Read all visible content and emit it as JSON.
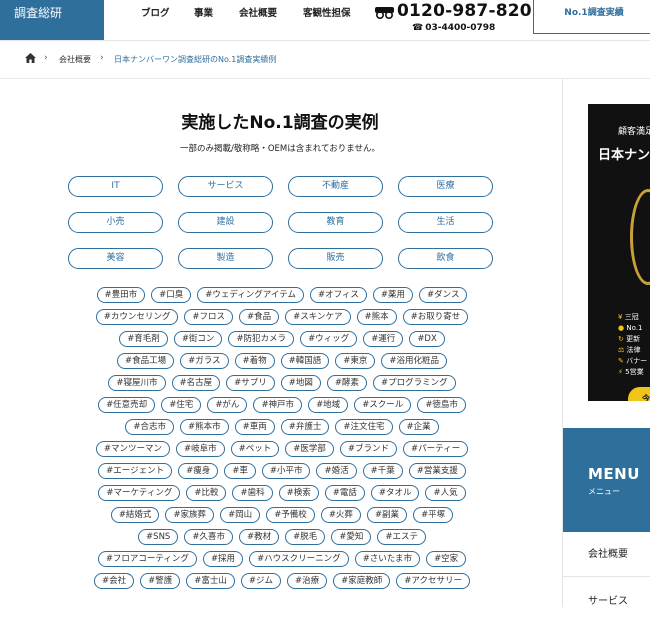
{
  "header": {
    "logo_text": "調査総研",
    "nav": [
      "ブログ",
      "事業",
      "会社概要",
      "客観性担保"
    ],
    "phone_number": "0120-987-820",
    "phone_sub": "03-4400-0798",
    "cta_label": "No.1調査実績"
  },
  "breadcrumb": {
    "items": [
      "会社概要",
      "日本ナンバーワン調査総研のNo.1調査実績例"
    ]
  },
  "main": {
    "title": "実施したNo.1調査の実例",
    "subtitle": "一部のみ掲載/敬称略・OEMは含まれておりません。",
    "categories": [
      "IT",
      "サービス",
      "不動産",
      "医療",
      "小売",
      "建設",
      "教育",
      "生活",
      "美容",
      "製造",
      "販売",
      "飲食"
    ],
    "tag_rows": [
      [
        "#豊田市",
        "#口臭",
        "#ウェディングアイテム",
        "#オフィス",
        "#薬用",
        "#ダンス"
      ],
      [
        "#カウンセリング",
        "#フロス",
        "#食品",
        "#スキンケア",
        "#熊本",
        "#お取り寄せ"
      ],
      [
        "#育毛剤",
        "#街コン",
        "#防犯カメラ",
        "#ウィッグ",
        "#運行",
        "#DX"
      ],
      [
        "#食品工場",
        "#ガラス",
        "#着物",
        "#韓国語",
        "#東京",
        "#浴用化粧品"
      ],
      [
        "#寝屋川市",
        "#名古屋",
        "#サプリ",
        "#地図",
        "#酵素",
        "#プログラミング"
      ],
      [
        "#任意売却",
        "#住宅",
        "#がん",
        "#神戸市",
        "#地域",
        "#スクール",
        "#徳島市"
      ],
      [
        "#合志市",
        "#熊本市",
        "#車両",
        "#弁護士",
        "#注文住宅",
        "#企業"
      ],
      [
        "#マンツーマン",
        "#岐阜市",
        "#ペット",
        "#医学部",
        "#ブランド",
        "#パーティー"
      ],
      [
        "#エージェント",
        "#痩身",
        "#車",
        "#小平市",
        "#婚活",
        "#千葉",
        "#営業支援"
      ],
      [
        "#マーケティング",
        "#比較",
        "#歯科",
        "#検索",
        "#電話",
        "#タオル",
        "#人気"
      ],
      [
        "#結婚式",
        "#家族葬",
        "#岡山",
        "#予備校",
        "#火葬",
        "#副業",
        "#平塚"
      ],
      [
        "#SNS",
        "#久喜市",
        "#教材",
        "#脱毛",
        "#愛知",
        "#エステ"
      ],
      [
        "#フロアコーティング",
        "#採用",
        "#ハウスクリーニング",
        "#さいたま市",
        "#空家"
      ],
      [
        "#会社",
        "#警護",
        "#富士山",
        "#ジム",
        "#治療",
        "#家庭教師",
        "#アクセサリー"
      ]
    ]
  },
  "sidebar": {
    "banner": {
      "line1": "顧客満足",
      "line2": "日本ナン",
      "points": [
        "三冠",
        "No.1",
        "更新",
        "法律",
        "バナー",
        "5営業"
      ],
      "cta": "今"
    },
    "menu_title": "MENU",
    "menu_sub": "メニュー",
    "links": [
      "会社概要",
      "サービス"
    ]
  }
}
